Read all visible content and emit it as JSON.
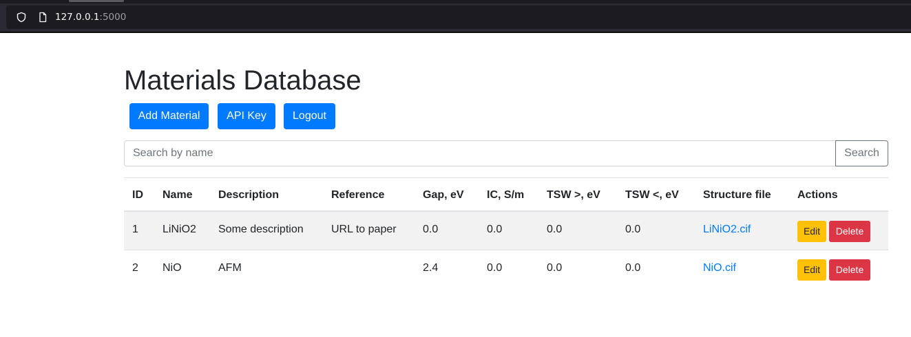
{
  "browser": {
    "url_host": "127.0.0.1",
    "url_port": ":5000"
  },
  "page": {
    "title": "Materials Database",
    "buttons": {
      "add_material": "Add Material",
      "api_key": "API Key",
      "logout": "Logout"
    },
    "search": {
      "placeholder": "Search by name",
      "button": "Search"
    }
  },
  "table": {
    "headers": {
      "id": "ID",
      "name": "Name",
      "description": "Description",
      "reference": "Reference",
      "gap": "Gap, eV",
      "ic": "IC, S/m",
      "tsw_gt": "TSW >, eV",
      "tsw_lt": "TSW <, eV",
      "structure_file": "Structure file",
      "actions": "Actions"
    },
    "rows": [
      {
        "id": "1",
        "name": "LiNiO2",
        "description": "Some description",
        "reference": "URL to paper",
        "gap": "0.0",
        "ic": "0.0",
        "tsw_gt": "0.0",
        "tsw_lt": "0.0",
        "structure_file": "LiNiO2.cif",
        "edit": "Edit",
        "delete": "Delete"
      },
      {
        "id": "2",
        "name": "NiO",
        "description": "AFM",
        "reference": "",
        "gap": "2.4",
        "ic": "0.0",
        "tsw_gt": "0.0",
        "tsw_lt": "0.0",
        "structure_file": "NiO.cif",
        "edit": "Edit",
        "delete": "Delete"
      }
    ]
  },
  "colors": {
    "primary": "#007bff",
    "warning": "#ffc107",
    "danger": "#dc3545",
    "striped_row": "#f2f2f2"
  },
  "icons": {
    "shield": "shield-icon",
    "page": "page-icon"
  }
}
